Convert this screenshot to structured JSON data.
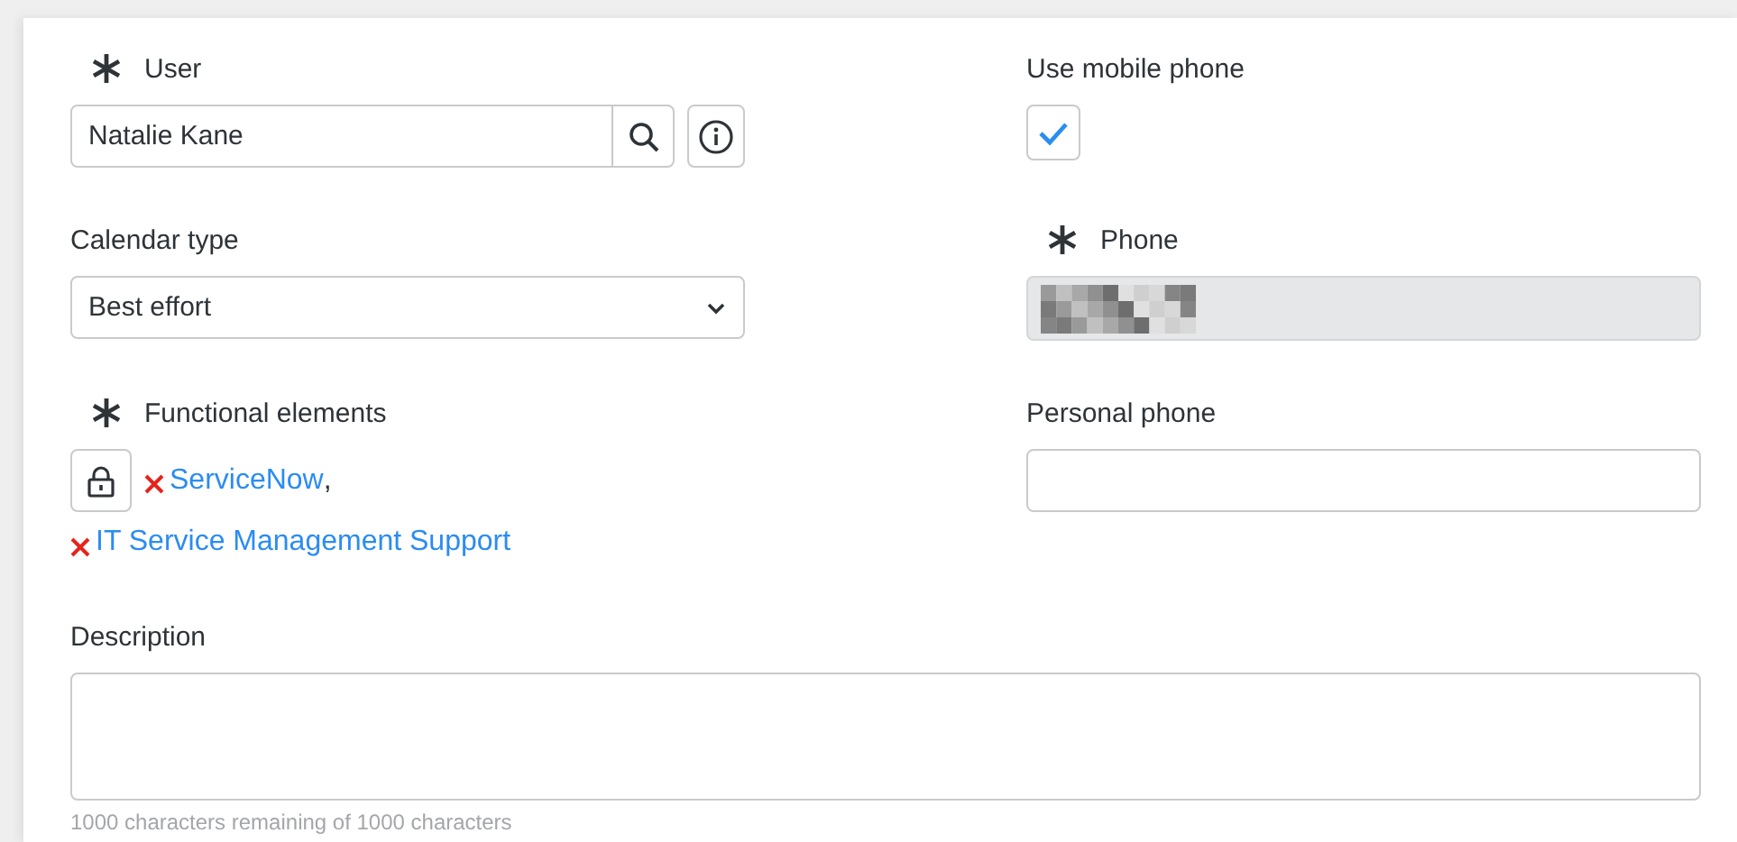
{
  "fields": [
    {
      "kind": "reference",
      "label": "User",
      "required": true,
      "value": "Natalie Kane"
    },
    {
      "kind": "checkbox",
      "label": "Use mobile phone",
      "required": false,
      "checked": true
    },
    {
      "kind": "select",
      "label": "Calendar type",
      "required": false,
      "value": "Best effort"
    },
    {
      "kind": "readonly",
      "label": "Phone",
      "required": true
    },
    {
      "kind": "tags",
      "label": "Functional elements",
      "required": true,
      "separator": ",",
      "items": [
        "ServiceNow",
        "IT Service Management Support"
      ]
    },
    {
      "kind": "text",
      "label": "Personal phone",
      "required": false
    }
  ],
  "description": {
    "label": "Description",
    "counter": "1000 characters remaining of 1000 characters"
  }
}
